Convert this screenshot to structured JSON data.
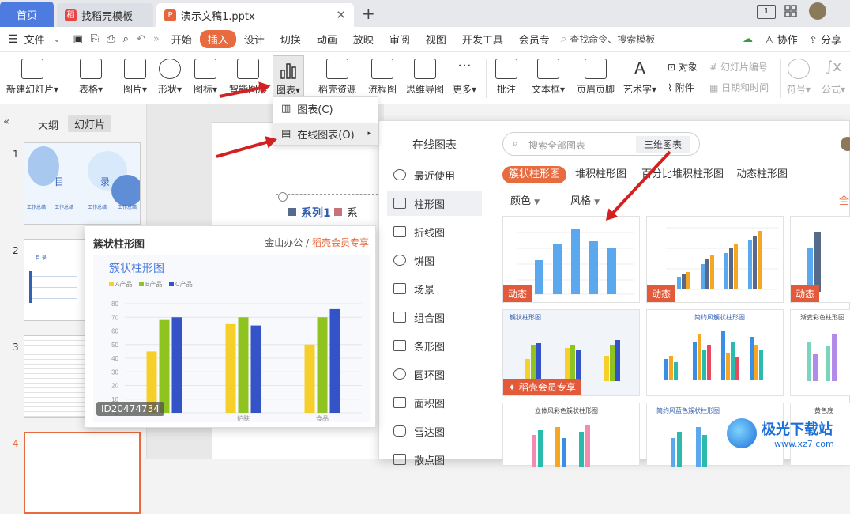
{
  "tabs": {
    "home": "首页",
    "template": "找稻壳模板",
    "doc": "演示文稿1.pptx",
    "new": "+"
  },
  "window": {
    "page_indicator": "1"
  },
  "menu": {
    "file": "文件",
    "items": [
      "开始",
      "插入",
      "设计",
      "切换",
      "动画",
      "放映",
      "审阅",
      "视图",
      "开发工具",
      "会员专"
    ],
    "active": "插入",
    "search": "查找命令、搜索模板",
    "right": [
      "协作",
      "分享"
    ]
  },
  "ribbon": {
    "new_slide": "新建幻灯片",
    "table": "表格",
    "picture": "图片",
    "shape": "形状",
    "icon": "图标",
    "smart": "智能图形",
    "chart": "图表",
    "daoke": "稻壳资源",
    "flow": "流程图",
    "mind": "思维导图",
    "more": "更多",
    "comment": "批注",
    "textbox": "文本框",
    "header": "页眉页脚",
    "wordart": "艺术字",
    "object": "对象",
    "attach": "附件",
    "slideno": "幻灯片编号",
    "datetime": "日期和时间",
    "symbol": "符号",
    "formula": "公式"
  },
  "left_panel": {
    "tab_outline": "大纲",
    "tab_slides": "幻灯片",
    "nums": [
      "1",
      "2",
      "3",
      "4"
    ],
    "slide1": {
      "title1": "目",
      "title2": "录",
      "items": [
        "工作总结",
        "工作总结",
        "工作总结",
        "工作总结"
      ]
    },
    "slide2": {
      "title": "目 录"
    }
  },
  "slide": {
    "text1": "系列1",
    "text2": "系"
  },
  "dropdown": {
    "item1": "图表(C)",
    "item2": "在线图表(O)"
  },
  "dialog": {
    "title": "在线图表",
    "search_placeholder": "搜索全部图表",
    "search_tag": "三维图表",
    "categories": [
      "最近使用",
      "柱形图",
      "折线图",
      "饼图",
      "场景",
      "组合图",
      "条形图",
      "圆环图",
      "面积图",
      "雷达图",
      "散点图"
    ],
    "selected_category": "柱形图",
    "subtabs": [
      "簇状柱形图",
      "堆积柱形图",
      "百分比堆积柱形图",
      "动态柱形图"
    ],
    "filters": {
      "color": "颜色",
      "style": "风格"
    },
    "more": "全",
    "badges": {
      "dynamic": "动态",
      "vip": "稻壳会员专享"
    },
    "card_titles": [
      "簇状柱形图",
      "简约风簇状柱形图",
      "渐变彩色柱形图",
      "立体风彩色簇状柱形图",
      "简约风蓝色簇状柱形图",
      "黄色底"
    ]
  },
  "preview": {
    "header": "簇状柱形图",
    "source": "金山办公 / ",
    "vip": "稻壳会员专享",
    "id": "ID20474734"
  },
  "chart_data": {
    "type": "bar",
    "title": "簇状柱形图",
    "categories": [
      "",
      "护肤",
      "食品"
    ],
    "series": [
      {
        "name": "A产品",
        "values": [
          45,
          65,
          50
        ],
        "color": "#f7cf2b"
      },
      {
        "name": "B产品",
        "values": [
          68,
          70,
          70
        ],
        "color": "#8fc31f"
      },
      {
        "name": "C产品",
        "values": [
          70,
          64,
          76
        ],
        "color": "#3453c6"
      }
    ],
    "ylim": [
      0,
      80
    ],
    "yticks": [
      0,
      10,
      20,
      30,
      40,
      50,
      60,
      70,
      80
    ],
    "legend": "top-left",
    "grid": true
  },
  "watermark": {
    "text": "极光下载站",
    "url": "www.xz7.com"
  },
  "colors": {
    "accent": "#e86b3f",
    "home_tab": "#4e7be0",
    "arrow": "#d32020",
    "bar_blue": "#5aa9ef"
  }
}
